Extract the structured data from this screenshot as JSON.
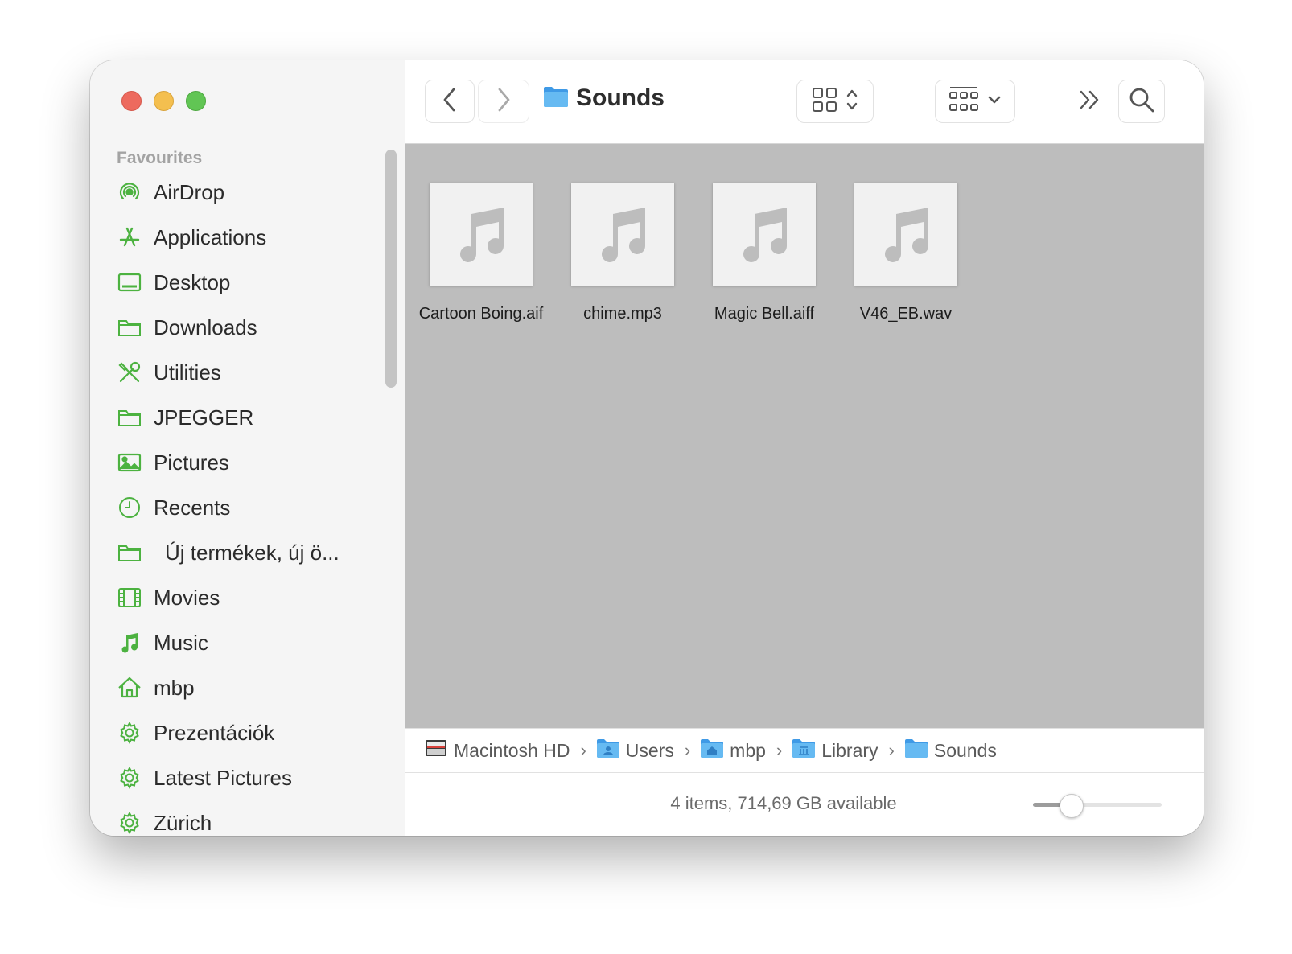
{
  "window": {
    "title": "Sounds",
    "accent_color": "#4cb240",
    "folder_color": "#5cb4ee"
  },
  "sidebar": {
    "section_label": "Favourites",
    "items": [
      {
        "label": "AirDrop",
        "icon": "airdrop-icon"
      },
      {
        "label": "Applications",
        "icon": "applications-icon"
      },
      {
        "label": "Desktop",
        "icon": "desktop-icon"
      },
      {
        "label": "Downloads",
        "icon": "folder-icon"
      },
      {
        "label": "Utilities",
        "icon": "utilities-icon"
      },
      {
        "label": "JPEGGER",
        "icon": "folder-icon"
      },
      {
        "label": "Pictures",
        "icon": "pictures-icon"
      },
      {
        "label": "Recents",
        "icon": "clock-icon"
      },
      {
        "label": "Új termékek, új ö...",
        "icon": "folder-icon"
      },
      {
        "label": "Movies",
        "icon": "film-icon"
      },
      {
        "label": "Music",
        "icon": "music-note-icon"
      },
      {
        "label": "mbp",
        "icon": "home-icon"
      },
      {
        "label": "Prezentációk",
        "icon": "gear-icon"
      },
      {
        "label": "Latest Pictures",
        "icon": "gear-icon"
      },
      {
        "label": "Zürich",
        "icon": "gear-icon"
      }
    ]
  },
  "files": [
    {
      "name": "Cartoon Boing.aif"
    },
    {
      "name": "chime.mp3"
    },
    {
      "name": "Magic Bell.aiff"
    },
    {
      "name": "V46_EB.wav"
    }
  ],
  "pathbar": [
    "Macintosh HD",
    "Users",
    "mbp",
    "Library",
    "Sounds"
  ],
  "status": {
    "text": "4 items, 714,69 GB available",
    "icon_size_fraction": 0.3
  }
}
